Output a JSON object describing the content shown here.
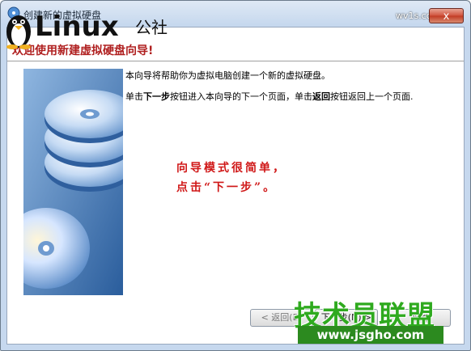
{
  "window": {
    "title": "创建新的虚拟硬盘",
    "close_glyph": "x"
  },
  "watermark_top": {
    "brand_latin": "Linux",
    "brand_cn": "公社",
    "small": "wv1s.com"
  },
  "header": {
    "title": "欢迎使用新建虚拟硬盘向导!"
  },
  "intro": {
    "line1": "本向导将帮助你为虚拟电脑创建一个新的虚拟硬盘。",
    "line2_pre": "单击",
    "line2_next": "下一步",
    "line2_mid": "按钮进入本向导的下一个页面，单击",
    "line2_back": "返回",
    "line2_post": "按钮返回上一个页面."
  },
  "annotation": {
    "line1": "向导模式很简单，",
    "line2": "点击“下一步”。"
  },
  "buttons": {
    "back": "< 返回(B)",
    "next": "下一步(N) >",
    "cancel": "取消"
  },
  "watermark_bottom": {
    "text": "技术员联盟",
    "url": "www.jsgho.com"
  },
  "colors": {
    "accent_red": "#d01818",
    "watermark_green": "#2faa1f",
    "titlebar_blue": "#c6d8ee"
  },
  "icons": {
    "title": "disk-icon",
    "side": "disk-stack-illustration"
  }
}
